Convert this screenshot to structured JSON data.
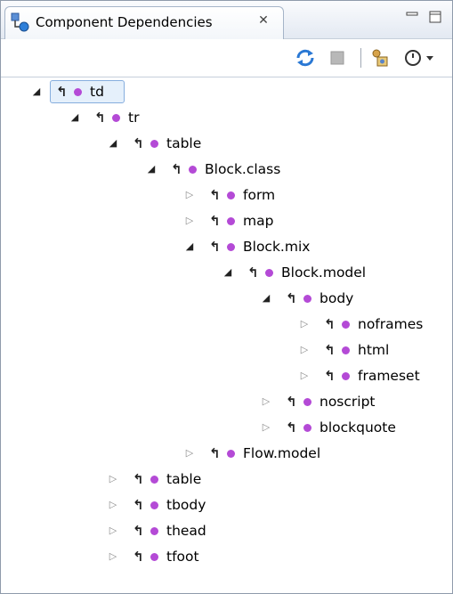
{
  "view": {
    "title": "Component Dependencies",
    "close_symbol": "✕",
    "tab_icon": "component-dependencies-icon"
  },
  "toolbar": {
    "buttons": [
      "refresh-icon",
      "stop-icon",
      "filter-icon",
      "view-menu-icon"
    ]
  },
  "tree": [
    {
      "label": "td",
      "depth": 0,
      "state": "expanded",
      "selected": true
    },
    {
      "label": "tr",
      "depth": 1,
      "state": "expanded"
    },
    {
      "label": "table",
      "depth": 2,
      "state": "expanded"
    },
    {
      "label": "Block.class",
      "depth": 3,
      "state": "expanded"
    },
    {
      "label": "form",
      "depth": 4,
      "state": "collapsed"
    },
    {
      "label": "map",
      "depth": 4,
      "state": "collapsed"
    },
    {
      "label": "Block.mix",
      "depth": 4,
      "state": "expanded"
    },
    {
      "label": "Block.model",
      "depth": 5,
      "state": "expanded"
    },
    {
      "label": "body",
      "depth": 6,
      "state": "expanded"
    },
    {
      "label": "noframes",
      "depth": 7,
      "state": "collapsed"
    },
    {
      "label": "html",
      "depth": 7,
      "state": "collapsed"
    },
    {
      "label": "frameset",
      "depth": 7,
      "state": "collapsed"
    },
    {
      "label": "noscript",
      "depth": 6,
      "state": "collapsed"
    },
    {
      "label": "blockquote",
      "depth": 6,
      "state": "collapsed"
    },
    {
      "label": "Flow.model",
      "depth": 4,
      "state": "collapsed"
    },
    {
      "label": "table",
      "depth": 2,
      "state": "collapsed"
    },
    {
      "label": "tbody",
      "depth": 2,
      "state": "collapsed"
    },
    {
      "label": "thead",
      "depth": 2,
      "state": "collapsed"
    },
    {
      "label": "tfoot",
      "depth": 2,
      "state": "collapsed"
    }
  ],
  "colors": {
    "node_dot": "#b44ad6",
    "selection_fill": "#e5f0fb",
    "selection_border": "#86aede"
  }
}
